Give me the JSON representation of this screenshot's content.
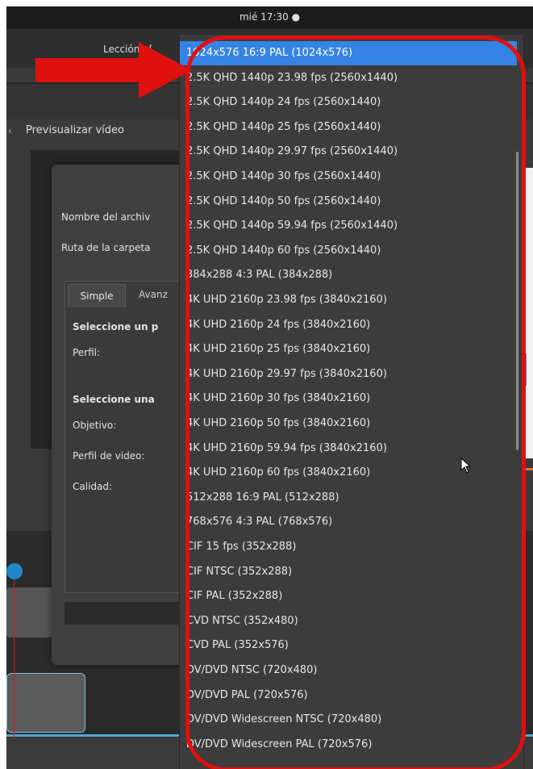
{
  "system": {
    "clock": "mié 17:30 ●"
  },
  "window": {
    "title": "Lección1 ["
  },
  "preview": {
    "title": "Previsualizar vídeo"
  },
  "dialog": {
    "file_name_label": "Nombre del archiv",
    "folder_path_label": "Ruta de la carpeta",
    "tab_simple": "Simple",
    "tab_advanced": "Avanz",
    "select_profile_heading": "Seleccione un p",
    "profile_label": "Perfil:",
    "select_target_heading": "Seleccione una",
    "target_label": "Objetivo:",
    "video_profile_label": "Perfil de video:",
    "quality_label": "Calidad:"
  },
  "dropdown": {
    "items": [
      "1024x576 16:9 PAL (1024x576)",
      "2.5K QHD 1440p 23.98 fps (2560x1440)",
      "2.5K QHD 1440p 24 fps (2560x1440)",
      "2.5K QHD 1440p 25 fps (2560x1440)",
      "2.5K QHD 1440p 29.97 fps (2560x1440)",
      "2.5K QHD 1440p 30 fps (2560x1440)",
      "2.5K QHD 1440p 50 fps (2560x1440)",
      "2.5K QHD 1440p 59.94 fps (2560x1440)",
      "2.5K QHD 1440p 60 fps (2560x1440)",
      "384x288 4:3 PAL (384x288)",
      "4K UHD 2160p 23.98 fps (3840x2160)",
      "4K UHD 2160p 24 fps (3840x2160)",
      "4K UHD 2160p 25 fps (3840x2160)",
      "4K UHD 2160p 29.97 fps (3840x2160)",
      "4K UHD 2160p 30 fps (3840x2160)",
      "4K UHD 2160p 50 fps (3840x2160)",
      "4K UHD 2160p 59.94 fps (3840x2160)",
      "4K UHD 2160p 60 fps (3840x2160)",
      "512x288 16:9 PAL (512x288)",
      "768x576 4:3 PAL (768x576)",
      "CIF 15 fps (352x288)",
      "CIF NTSC (352x288)",
      "CIF PAL (352x288)",
      "CVD NTSC (352x480)",
      "CVD PAL (352x576)",
      "DV/DVD NTSC (720x480)",
      "DV/DVD PAL (720x576)",
      "DV/DVD Widescreen NTSC (720x480)",
      "DV/DVD Widescreen PAL (720x576)"
    ],
    "selected_index": 0,
    "more_below_icon": "▾"
  },
  "colors": {
    "annotation_red": "#e01010",
    "selection_blue": "#3584e4",
    "menu_bg": "#3c3c3c"
  }
}
